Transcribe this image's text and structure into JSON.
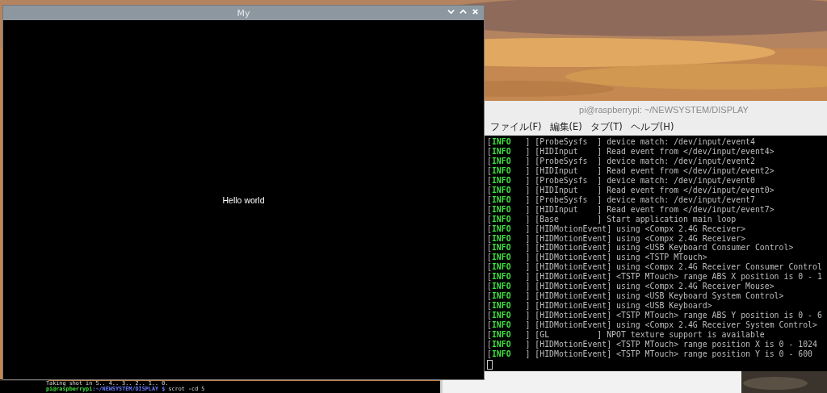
{
  "app_window": {
    "title": "My",
    "body_text": "Hello world"
  },
  "terminal": {
    "title": "pi@raspberrypi: ~/NEWSYSTEM/DISPLAY",
    "menu": [
      "ファイル(F)",
      "編集(E)",
      "タブ(T)",
      "ヘルプ(H)"
    ],
    "lines": [
      {
        "open": "[",
        "level": "INFO",
        "rest": "   ] [ProbeSysfs  ] device match: /dev/input/event4"
      },
      {
        "open": "[",
        "level": "INFO",
        "rest": "   ] [HIDInput    ] Read event from </dev/input/event4>"
      },
      {
        "open": "[",
        "level": "INFO",
        "rest": "   ] [ProbeSysfs  ] device match: /dev/input/event2"
      },
      {
        "open": "[",
        "level": "INFO",
        "rest": "   ] [HIDInput    ] Read event from </dev/input/event2>"
      },
      {
        "open": "[",
        "level": "INFO",
        "rest": "   ] [ProbeSysfs  ] device match: /dev/input/event0"
      },
      {
        "open": "[",
        "level": "INFO",
        "rest": "   ] [HIDInput    ] Read event from </dev/input/event0>"
      },
      {
        "open": "[",
        "level": "INFO",
        "rest": "   ] [ProbeSysfs  ] device match: /dev/input/event7"
      },
      {
        "open": "[",
        "level": "INFO",
        "rest": "   ] [HIDInput    ] Read event from </dev/input/event7>"
      },
      {
        "open": "[",
        "level": "INFO",
        "rest": "   ] [Base        ] Start application main loop"
      },
      {
        "open": "[",
        "level": "INFO",
        "rest": "   ] [HIDMotionEvent] using <Compx 2.4G Receiver>"
      },
      {
        "open": "[",
        "level": "INFO",
        "rest": "   ] [HIDMotionEvent] using <Compx 2.4G Receiver>"
      },
      {
        "open": "[",
        "level": "INFO",
        "rest": "   ] [HIDMotionEvent] using <USB Keyboard Consumer Control>"
      },
      {
        "open": "[",
        "level": "INFO",
        "rest": "   ] [HIDMotionEvent] using <TSTP MTouch>"
      },
      {
        "open": "[",
        "level": "INFO",
        "rest": "   ] [HIDMotionEvent] using <Compx 2.4G Receiver Consumer Control"
      },
      {
        "open": "[",
        "level": "INFO",
        "rest": "   ] [HIDMotionEvent] <TSTP MTouch> range ABS X position is 0 - 1"
      },
      {
        "open": "[",
        "level": "INFO",
        "rest": "   ] [HIDMotionEvent] using <Compx 2.4G Receiver Mouse>"
      },
      {
        "open": "[",
        "level": "INFO",
        "rest": "   ] [HIDMotionEvent] using <USB Keyboard System Control>"
      },
      {
        "open": "[",
        "level": "INFO",
        "rest": "   ] [HIDMotionEvent] using <USB Keyboard>"
      },
      {
        "open": "[",
        "level": "INFO",
        "rest": "   ] [HIDMotionEvent] <TSTP MTouch> range ABS Y position is 0 - 6"
      },
      {
        "open": "[",
        "level": "INFO",
        "rest": "   ] [HIDMotionEvent] using <Compx 2.4G Receiver System Control>"
      },
      {
        "open": "[",
        "level": "INFO",
        "rest": "   ] [GL          ] NPOT texture support is available"
      },
      {
        "open": "[",
        "level": "INFO",
        "rest": "   ] [HIDMotionEvent] <TSTP MTouch> range position X is 0 - 1024"
      },
      {
        "open": "[",
        "level": "INFO",
        "rest": "   ] [HIDMotionEvent] <TSTP MTouch> range position Y is 0 - 600"
      }
    ]
  },
  "back_terminal": {
    "output": "Taking shot in 5.. 4.. 3.. 2.. 1.. 0.",
    "prompt_user": "pi@raspberrypi",
    "prompt_path": ":~/NEWSYSTEM/DISPLAY $",
    "command": " scrot -cd 5"
  }
}
